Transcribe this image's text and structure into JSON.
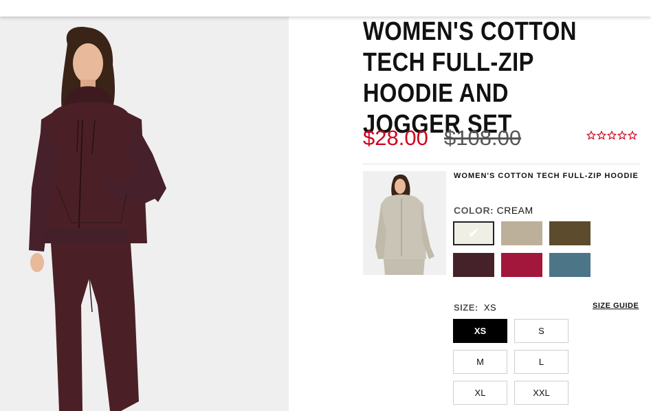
{
  "product": {
    "title": "WOMEN'S COTTON TECH FULL-ZIP HOODIE AND JOGGER SET",
    "sale_price": "$28.00",
    "original_price": "$108.00",
    "rating": 0,
    "rating_max": 5
  },
  "item": {
    "title": "WOMEN'S COTTON TECH FULL-ZIP HOODIE",
    "color_label": "COLOR:",
    "color_value": "CREAM",
    "colors": [
      {
        "name": "cream",
        "hex": "#efefe5",
        "selected": true
      },
      {
        "name": "khaki",
        "hex": "#bdb09a",
        "selected": false
      },
      {
        "name": "olive",
        "hex": "#5c4b2c",
        "selected": false
      },
      {
        "name": "burgundy",
        "hex": "#452229",
        "selected": false
      },
      {
        "name": "red",
        "hex": "#a3173c",
        "selected": false
      },
      {
        "name": "teal",
        "hex": "#4c7587",
        "selected": false
      }
    ],
    "check_glyph": "✔",
    "size_label": "SIZE:",
    "size_value": "XS",
    "size_guide": "SIZE GUIDE",
    "sizes": [
      {
        "label": "XS",
        "selected": true
      },
      {
        "label": "S",
        "selected": false
      },
      {
        "label": "M",
        "selected": false
      },
      {
        "label": "L",
        "selected": false
      },
      {
        "label": "XL",
        "selected": false
      },
      {
        "label": "XXL",
        "selected": false
      }
    ]
  },
  "colors": {
    "sale": "#d0021b",
    "star": "#d0021b",
    "garment_main": "#4a2026",
    "garment_thumb": "#c9c4b5"
  }
}
